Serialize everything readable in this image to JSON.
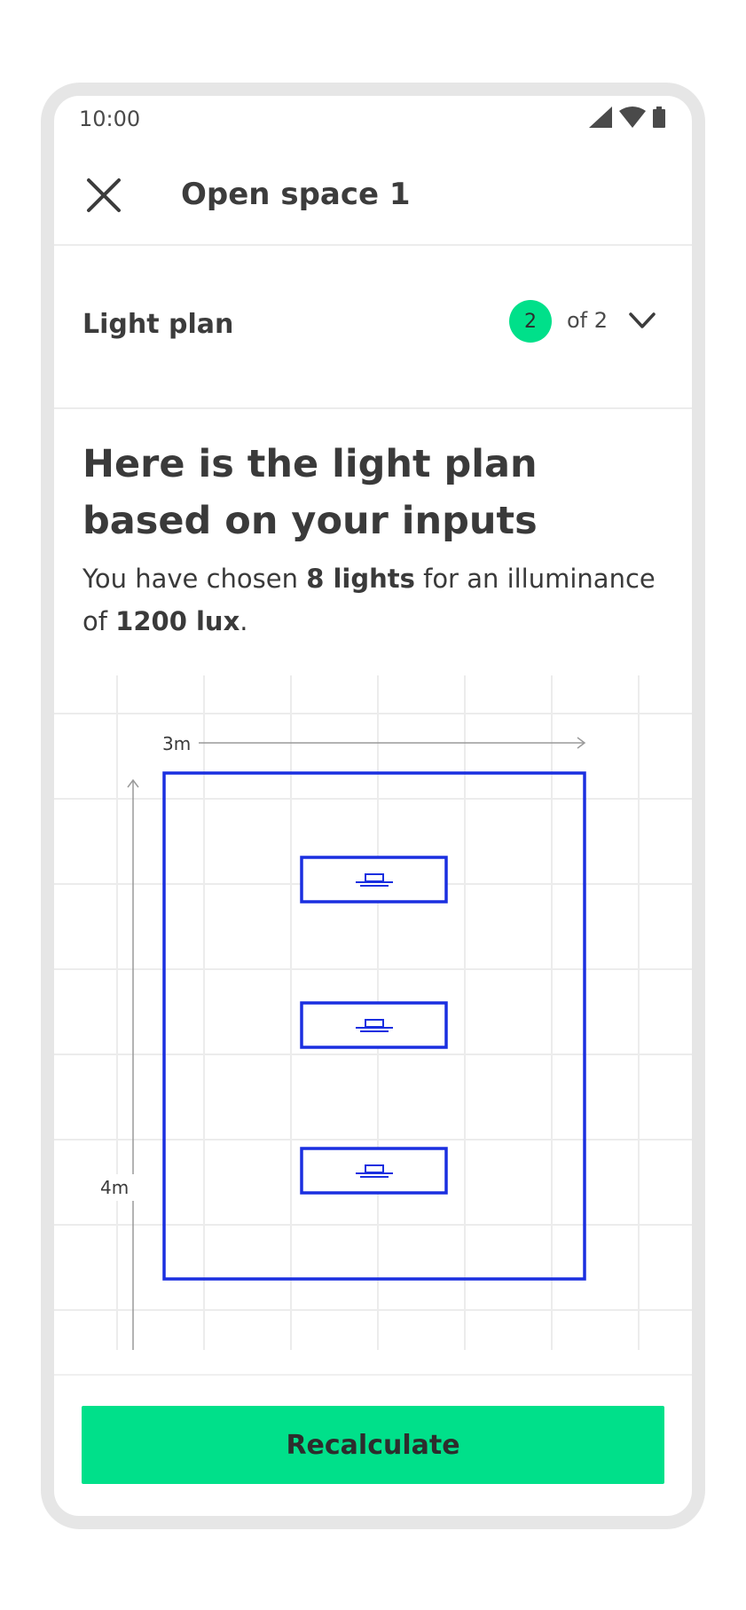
{
  "status_bar": {
    "time": "10:00"
  },
  "app_bar": {
    "title": "Open space 1",
    "close_icon": "close-icon"
  },
  "stepper": {
    "label": "Light plan",
    "current": "2",
    "of_text": "of 2"
  },
  "content": {
    "heading": "Here is the light plan based on your inputs",
    "summary_prefix": "You have chosen ",
    "summary_lights": "8 lights",
    "summary_middle": " for an illuminance of ",
    "summary_lux": "1200 lux",
    "summary_suffix": "."
  },
  "plan": {
    "width_label": "3m",
    "height_label": "4m",
    "light_count_shown": 3
  },
  "actions": {
    "recalculate_label": "Recalculate"
  },
  "colors": {
    "accent": "#00e08a",
    "plan_blue": "#1a2fe0",
    "grid": "#ececec"
  }
}
